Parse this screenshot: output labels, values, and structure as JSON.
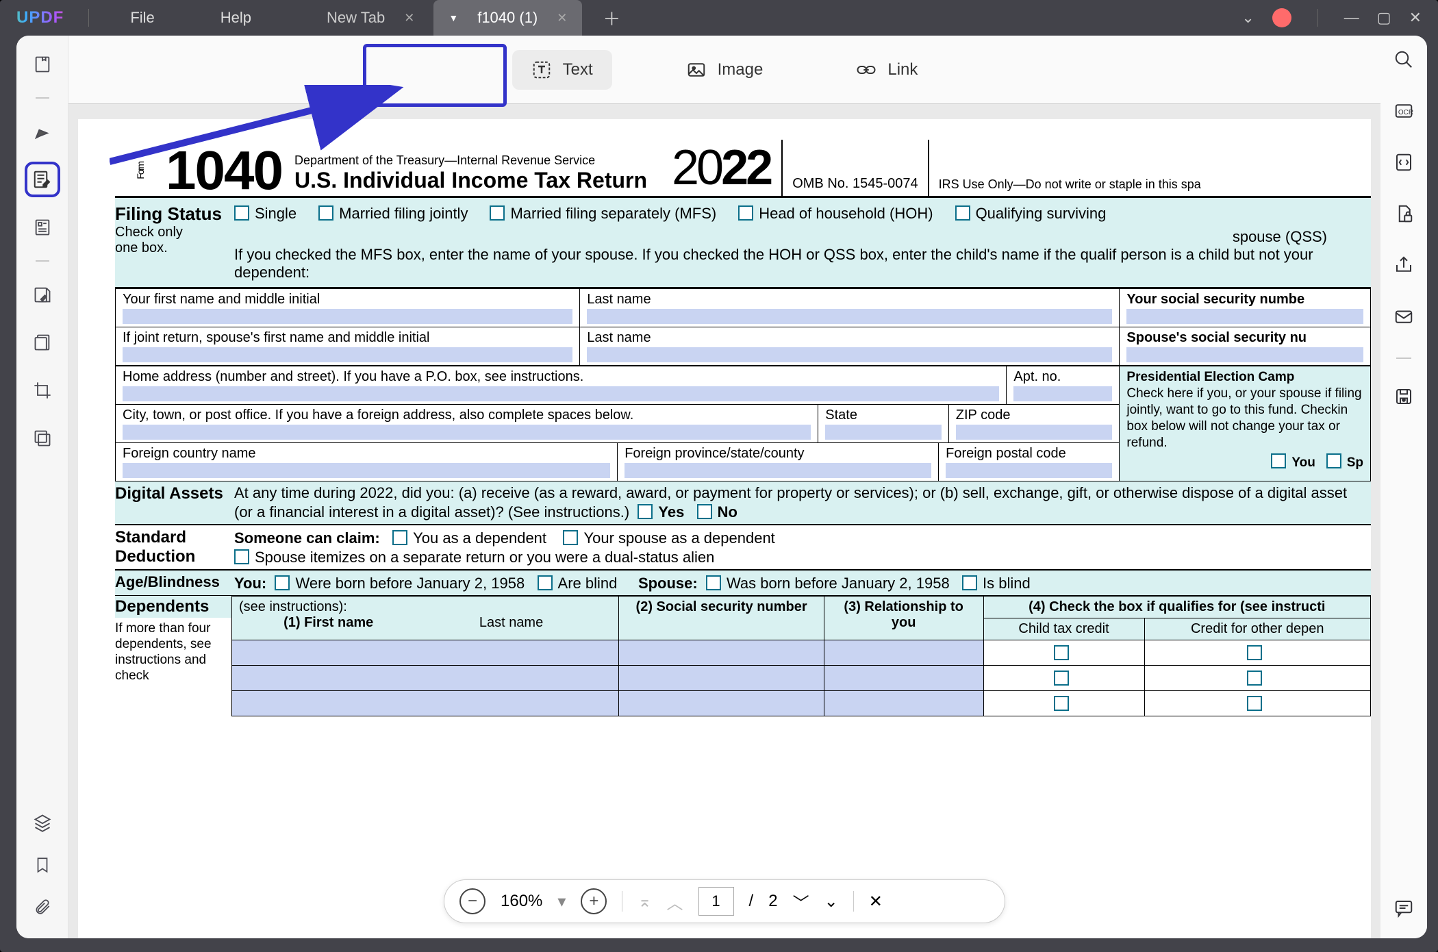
{
  "menu": {
    "file": "File",
    "help": "Help"
  },
  "tabs": {
    "new_tab": "New Tab",
    "doc_tab": "f1040 (1)"
  },
  "toolbar": {
    "text": "Text",
    "image": "Image",
    "link": "Link"
  },
  "zoom": {
    "pct": "160%",
    "page_current": "1",
    "page_sep": "/",
    "page_total": "2"
  },
  "form": {
    "number": "1040",
    "dept": "Department of the Treasury—Internal Revenue Service",
    "title": "U.S. Individual Income Tax Return",
    "year_a": "20",
    "year_b": "22",
    "omb": "OMB No. 1545-0074",
    "irs_only": "IRS Use Only—Do not write or staple in this spa",
    "filing_status": "Filing Status",
    "check_only": "Check only",
    "one_box": "one box.",
    "fs_single": "Single",
    "fs_mfj": "Married filing jointly",
    "fs_mfs": "Married filing separately (MFS)",
    "fs_hoh": "Head of household (HOH)",
    "fs_qss1": "Qualifying surviving",
    "fs_qss2": "spouse (QSS)",
    "fs_note": "If you checked the MFS box, enter the name of your spouse. If you checked the HOH or QSS box, enter the child's name if the qualif person is a child but not your dependent:",
    "f_first": "Your first name and middle initial",
    "f_last": "Last name",
    "f_ssn": "Your social security numbe",
    "f_sp_first": "If joint return, spouse's first name and middle initial",
    "f_sp_last": "Last name",
    "f_sp_ssn": "Spouse's social security nu",
    "f_addr": "Home address (number and street). If you have a P.O. box, see instructions.",
    "f_apt": "Apt. no.",
    "f_pec": "Presidential Election Camp",
    "f_pec_text": "Check here if you, or your spouse if filing jointly, want to go to this fund. Checkin box below will not change your tax or refund.",
    "f_pec_you": "You",
    "f_pec_sp": "Sp",
    "f_city": "City, town, or post office. If you have a foreign address, also complete spaces below.",
    "f_state": "State",
    "f_zip": "ZIP code",
    "f_fc": "Foreign country name",
    "f_fp": "Foreign province/state/county",
    "f_fz": "Foreign postal code",
    "digital_hdr": "Digital Assets",
    "digital_q": "At any time during 2022, did you: (a) receive (as a reward, award, or payment for property or services); or (b) sell, exchange, gift, or otherwise dispose of a digital asset (or a financial interest in a digital asset)? (See instructions.)",
    "yes": "Yes",
    "no": "No",
    "std_hdr": "Standard Deduction",
    "someone": "Someone can claim:",
    "you_dep": "You as a dependent",
    "sp_dep": "Your spouse as a dependent",
    "sp_item": "Spouse itemizes on a separate return or you were a dual-status alien",
    "age_hdr": "Age/Blindness",
    "you_lbl": "You:",
    "sp_lbl": "Spouse:",
    "born": "Were born before January 2, 1958",
    "born2": "Was born before January 2, 1958",
    "blind": "Are blind",
    "blind2": "Is blind",
    "dep_hdr": "Dependents",
    "dep_see": "(see instructions):",
    "dep_more": "If more than four dependents, see instructions and check",
    "dep_c1": "(1) First name",
    "dep_c1b": "Last name",
    "dep_c2": "(2) Social security number",
    "dep_c3": "(3) Relationship to you",
    "dep_c4": "(4) Check the box if qualifies for (see instructi",
    "dep_ctc": "Child tax credit",
    "dep_odc": "Credit for other depen"
  }
}
